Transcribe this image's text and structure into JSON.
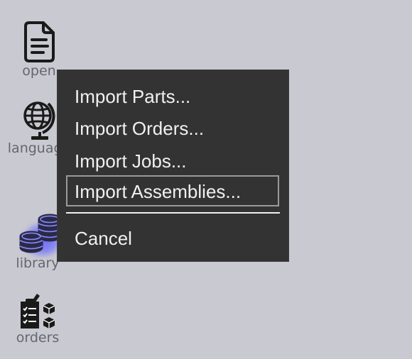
{
  "sidebar": {
    "items": [
      {
        "label": "open",
        "icon": "document-icon"
      },
      {
        "label": "language",
        "icon": "globe-icon"
      },
      {
        "label": "library",
        "icon": "coins-stack-icon",
        "state": "highlighted"
      },
      {
        "label": "orders",
        "icon": "checklist-boxes-icon"
      }
    ]
  },
  "menu": {
    "items": [
      {
        "label": "Import Parts..."
      },
      {
        "label": "Import Orders..."
      },
      {
        "label": "Import Jobs..."
      },
      {
        "label": "Import Assemblies...",
        "focused": true
      }
    ],
    "cancel_label": "Cancel"
  },
  "colors": {
    "background": "#c9c9d1",
    "menu_background": "#333333",
    "menu_text": "#f0f0f0",
    "sidebar_label": "#666670",
    "highlight_glow": "#6e6eff",
    "focus_border": "#9a9a9a"
  }
}
